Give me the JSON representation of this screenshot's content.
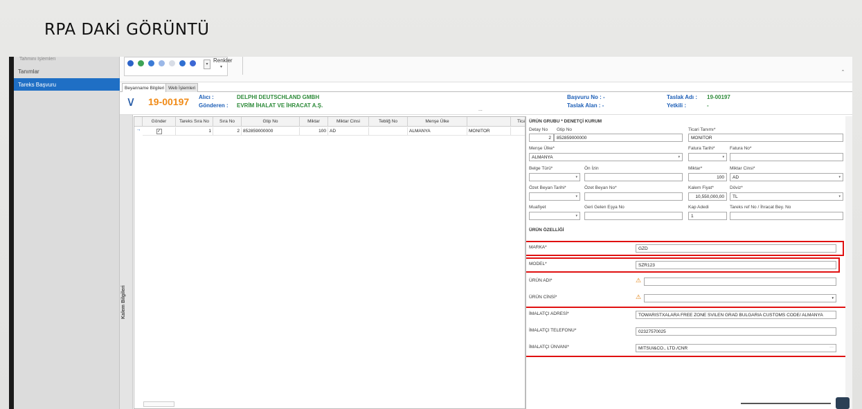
{
  "slide": {
    "title": "RPA DAKİ GÖRÜNTÜ"
  },
  "sidebar": {
    "cut_item": "Tahmini İşlemleri",
    "items": [
      {
        "label": "Tanımlar",
        "active": false
      },
      {
        "label": "Tareks Başvuru",
        "active": true
      }
    ]
  },
  "ribbon": {
    "colors_label": "Renkler",
    "colors_caret": "▾",
    "dropdown_glyph": "▾",
    "collapse_glyph": "ˆ",
    "icons": [
      "star-icon",
      "globe-icon",
      "globe-icon",
      "globe-icon",
      "globe-icon",
      "globe-icon",
      "globe-icon"
    ],
    "icon_colors": [
      "#2c63c8",
      "#3da356",
      "#3b7bd6",
      "#9bb8e8",
      "#d8dde6",
      "#2f6fd1",
      "#3c67d4"
    ]
  },
  "tabs": [
    {
      "label": "Beyanname Bilgileri",
      "active": true
    },
    {
      "label": "Web İşlemleri",
      "active": false
    }
  ],
  "header": {
    "chevron": "∨",
    "code": "19-00197",
    "alici_label": "Alıcı :",
    "alici_value": "DELPHI DEUTSCHLAND GMBH",
    "gonderen_label": "Gönderen :",
    "gonderen_value": "EVRİM İHALAT VE İHRACAT A.Ş.",
    "basvuru_no_label": "Başvuru No : -",
    "taslak_alan_label": "Taslak Alan : -",
    "taslak_adi_label": "Taslak Adı :",
    "taslak_adi_value": "19-00197",
    "yetkili_label": "Yetkili :",
    "yetkili_value": "-",
    "dots": "..."
  },
  "side_strip": {
    "label": "Kalem Bilgileri"
  },
  "grid": {
    "columns": [
      "Gönder",
      "Tareks Sıra No",
      "Sıra No",
      "Gtip No",
      "Miktar",
      "Miktar Cinsi",
      "Tebliğ No",
      "Menşe Ülke",
      "",
      "Tica"
    ],
    "rows": [
      {
        "indicator": "→",
        "gonder": "✓",
        "tareks_sira": "1",
        "sira": "2",
        "gtip": "852859000000",
        "miktar": "100",
        "miktar_cinsi": "AD",
        "teblig": "",
        "mense": "ALMANYA",
        "tanim": "MONITOR"
      }
    ]
  },
  "detail": {
    "group_header": "ÜRÜN GRUBU  *  DENETÇİ KURUM",
    "labels": {
      "detay_no": "Detay No",
      "gtip_no": "Gtip No",
      "ticari_tanim": "Ticari Tanımı*",
      "mense_ulke": "Menşe Ülke*",
      "fatura_tarihi": "Fatura Tarihi*",
      "fatura_no": "Fatura No*",
      "belge_turu": "Belge Türü*",
      "on_izin": "Ön İzin",
      "miktar": "Miktar*",
      "miktar_cinsi": "Miktar Cinsi*",
      "ozet_beyan_tarihi": "Özet Beyan Tarihi*",
      "ozet_beyan_no": "Özet Beyan No*",
      "kalem_fiyat": "Kalem Fiyat*",
      "doviz": "Döviz*",
      "muafiyet": "Muafiyet",
      "geri_gelen": "Geri Gelen Eşya No",
      "kap_adedi": "Kap Adedi",
      "tareks_ref": "Tareks ref No / İhracat Bey. No"
    },
    "values": {
      "detay_no": "2",
      "gtip_no": "852859000000",
      "ticari_tanim": "MONITOR",
      "mense_ulke": "ALMANYA",
      "miktar": "100",
      "miktar_cinsi": "AD",
      "kalem_fiyat": "10,550,000,00",
      "doviz": "TL",
      "kap_adedi": "1"
    },
    "dropdown_glyph": "▾"
  },
  "product": {
    "header": "ÜRÜN ÖZELLİĞİ",
    "warn_glyph": "⚠",
    "more_glyph": "···",
    "fields": [
      {
        "label": "MARKA*",
        "value": "GZD"
      },
      {
        "label": "MODEL*",
        "value": "SZR123"
      },
      {
        "label": "ÜRÜN ADI*",
        "value": ""
      },
      {
        "label": "ÜRÜN CİNSİ*",
        "value": ""
      },
      {
        "label": "İMALATÇI ADRESİ*",
        "value": "TOWARISTXALARA FREE ZONE SVILEN GRAD BULGARIA CUSTOMS CODE/ ALMANYA"
      },
      {
        "label": "İMALATÇI TELEFONU*",
        "value": "02327570025"
      },
      {
        "label": "İMALATÇI ÜNVANI*",
        "value": "MITSUI&CO., LTD./CNR"
      }
    ]
  },
  "colors": {
    "accent": "#1f6fc5",
    "code": "#f08a16",
    "link": "#1d5fb7",
    "green": "#2e8b3a",
    "highlight": "#e01010"
  }
}
